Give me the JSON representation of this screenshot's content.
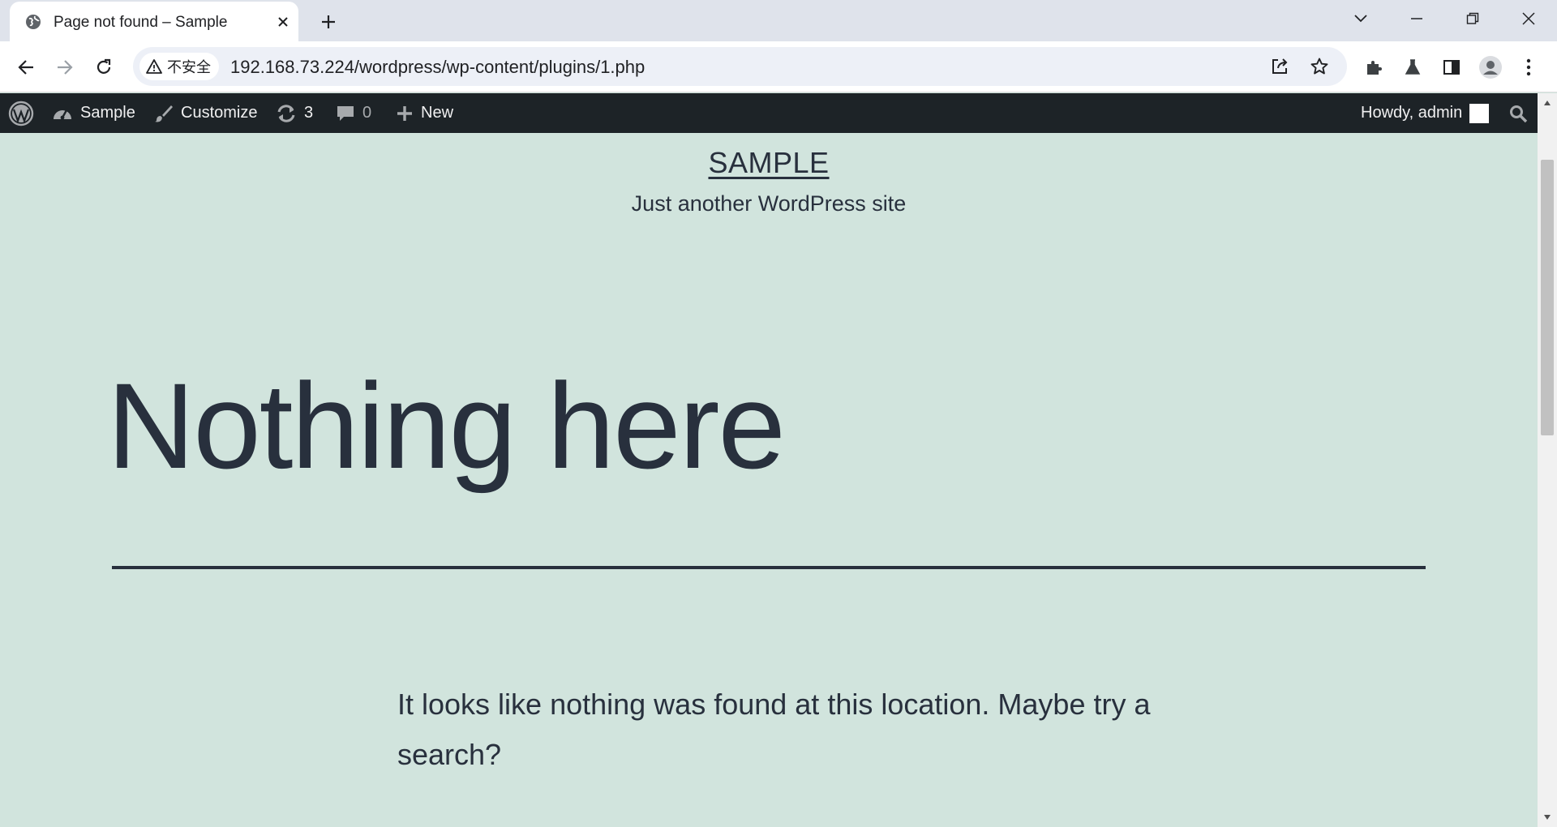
{
  "browser": {
    "tab": {
      "title": "Page not found – Sample"
    },
    "address": {
      "security_label": "不安全",
      "url": "192.168.73.224/wordpress/wp-content/plugins/1.php"
    }
  },
  "adminbar": {
    "site_name": "Sample",
    "customize": "Customize",
    "updates_count": "3",
    "comments_count": "0",
    "new_label": "New",
    "howdy": "Howdy, admin"
  },
  "site": {
    "title": "SAMPLE",
    "description": "Just another WordPress site"
  },
  "content": {
    "heading": "Nothing here",
    "message": "It looks like nothing was found at this location. Maybe try a search?"
  },
  "colors": {
    "background": "#d1e4dd",
    "text": "#28303d",
    "adminbar": "#1d2327"
  }
}
